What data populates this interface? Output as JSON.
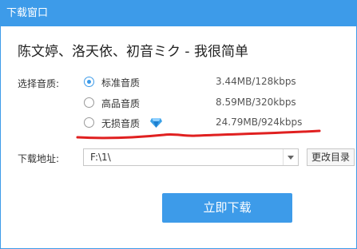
{
  "window": {
    "title": "下载窗口"
  },
  "song": {
    "title": "陈文婷、洛天依、初音ミク - 我很简单"
  },
  "quality": {
    "label": "选择音质:",
    "options": [
      {
        "name": "标准音质",
        "size": "3.44MB/128kbps",
        "selected": true
      },
      {
        "name": "高品音质",
        "size": "8.59MB/320kbps",
        "selected": false
      },
      {
        "name": "无损音质",
        "size": "24.79MB/924kbps",
        "selected": false
      }
    ],
    "premium_icon": "diamond-icon"
  },
  "path": {
    "label": "下载地址:",
    "value": "F:\\1\\",
    "change_label": "更改目录"
  },
  "actions": {
    "download_label": "立即下载"
  },
  "colors": {
    "accent": "#3d9be9",
    "annotation": "#e02020"
  }
}
